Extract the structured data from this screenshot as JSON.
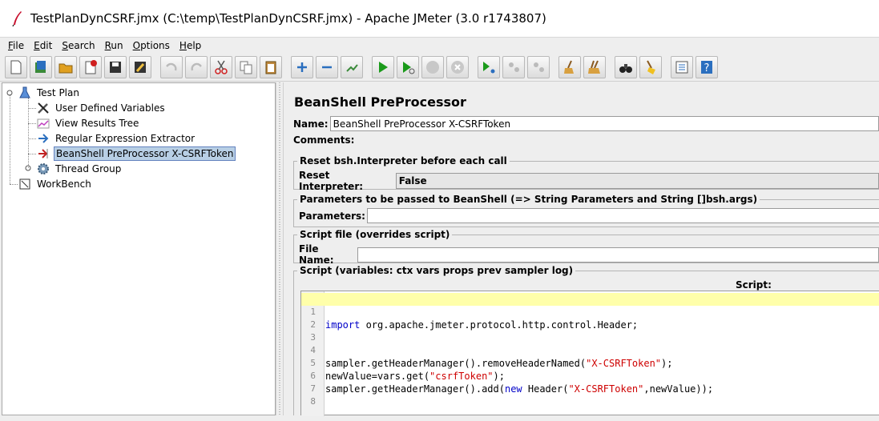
{
  "window": {
    "title": "TestPlanDynCSRF.jmx (C:\\temp\\TestPlanDynCSRF.jmx) - Apache JMeter (3.0 r1743807)"
  },
  "menu": [
    {
      "first": "F",
      "rest": "ile"
    },
    {
      "first": "E",
      "rest": "dit"
    },
    {
      "first": "S",
      "rest": "earch"
    },
    {
      "first": "R",
      "rest": "un"
    },
    {
      "first": "O",
      "rest": "ptions"
    },
    {
      "first": "H",
      "rest": "elp"
    }
  ],
  "tree": {
    "test_plan": "Test Plan",
    "user_defined_variables": "User Defined Variables",
    "view_results_tree": "View Results Tree",
    "regex_extractor": "Regular Expression Extractor",
    "beanshell_preprocessor": "BeanShell PreProcessor X-CSRFToken",
    "thread_group": "Thread Group",
    "workbench": "WorkBench"
  },
  "panel": {
    "title": "BeanShell PreProcessor",
    "name_label": "Name:",
    "name_value": "BeanShell PreProcessor X-CSRFToken",
    "comments_label": "Comments:",
    "reset_group": "Reset bsh.Interpreter before each call",
    "reset_label": "Reset Interpreter:",
    "reset_value": "False",
    "params_group": "Parameters to be passed to BeanShell (=> String Parameters and String []bsh.args)",
    "params_label": "Parameters:",
    "params_value": "",
    "file_group": "Script file (overrides script)",
    "file_label": "File Name:",
    "file_value": "",
    "script_group": "Script (variables: ctx vars props prev sampler log)",
    "script_label": "Script:"
  },
  "script": {
    "line_numbers": [
      "1",
      "2",
      "3",
      "4",
      "5",
      "6",
      "7",
      "8"
    ],
    "l1_kw": "import",
    "l1_rest": " org.apache.jmeter.protocol.http.control.Header;",
    "l4_a": "sampler.getHeaderManager().removeHeaderNamed(",
    "l4_str": "\"X-CSRFToken\"",
    "l4_b": ");",
    "l5_a": "newValue=vars.get(",
    "l5_str": "\"csrfToken\"",
    "l5_b": ");",
    "l6_a": "sampler.getHeaderManager().add(",
    "l6_kw": "new",
    "l6_b": " Header(",
    "l6_str": "\"X-CSRFToken\"",
    "l6_c": ",newValue));"
  }
}
